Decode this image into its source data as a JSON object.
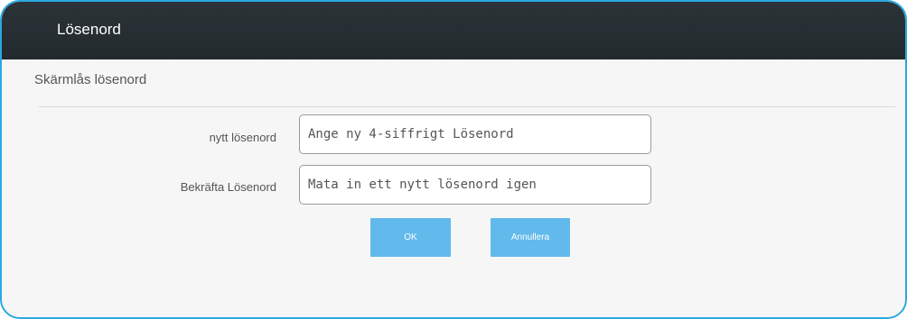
{
  "window": {
    "title": "Lösenord"
  },
  "section": {
    "header": "Skärmlås lösenord"
  },
  "form": {
    "new_password": {
      "label": "nytt lösenord",
      "value": "",
      "placeholder": "Ange ny 4-siffrigt Lösenord"
    },
    "confirm_password": {
      "label": "Bekräfta Lösenord",
      "value": "",
      "placeholder": "Mata in ett nytt lösenord igen"
    }
  },
  "buttons": {
    "ok_label": "OK",
    "cancel_label": "Annullera"
  },
  "colors": {
    "accent_border": "#29a8e0",
    "titlebar": "#262e32",
    "button": "#62b9eb"
  }
}
